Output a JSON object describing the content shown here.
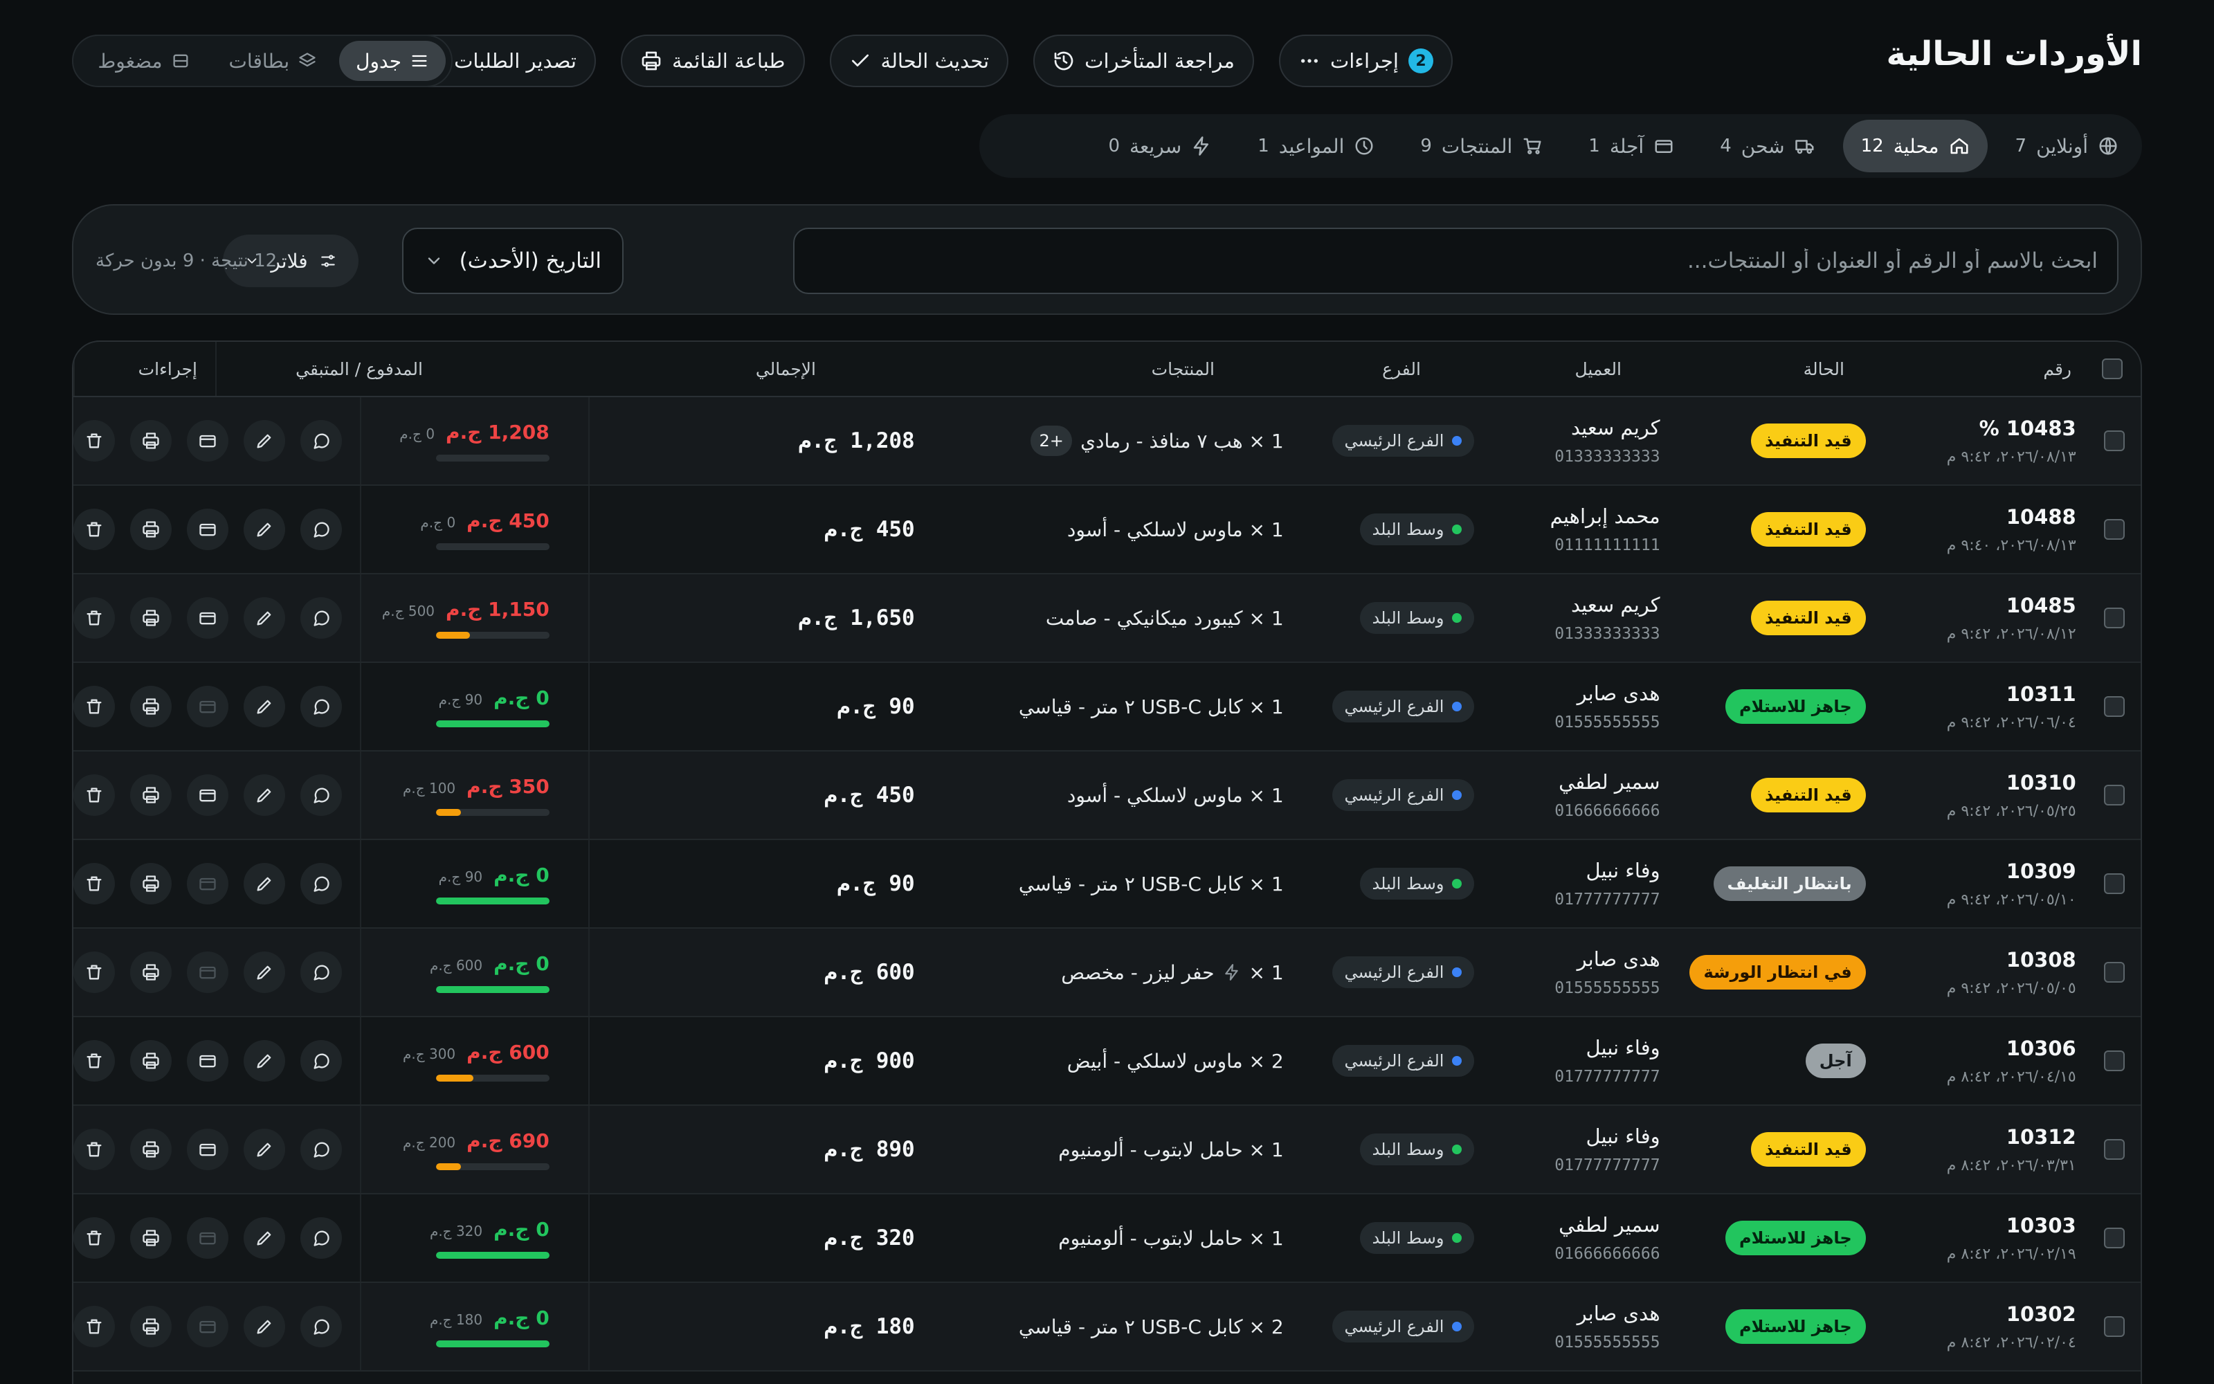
{
  "header": {
    "title": "الأوردات الحالية",
    "actions_label": "إجراءات",
    "actions_badge": "2",
    "review_late_label": "مراجعة المتأخرات",
    "update_status_label": "تحديث الحالة",
    "print_list_label": "طباعة القائمة",
    "export_orders_label": "تصدير الطلبات",
    "view_modes": [
      {
        "label": "جدول",
        "icon": "list-icon",
        "active": true
      },
      {
        "label": "بطاقات",
        "icon": "layers-icon",
        "active": false
      },
      {
        "label": "مضغوط",
        "icon": "compact-icon",
        "active": false
      }
    ]
  },
  "tabs": [
    {
      "label": "أونلاين",
      "count": "7",
      "icon": "globe-icon",
      "active": false
    },
    {
      "label": "محلية",
      "count": "12",
      "icon": "home-icon",
      "active": true
    },
    {
      "label": "شحن",
      "count": "4",
      "icon": "truck-icon",
      "active": false
    },
    {
      "label": "آجلة",
      "count": "1",
      "icon": "wallet-icon",
      "active": false
    },
    {
      "label": "المنتجات",
      "count": "9",
      "icon": "cart-icon",
      "active": false
    },
    {
      "label": "المواعيد",
      "count": "1",
      "icon": "clock-icon",
      "active": false
    },
    {
      "label": "سريعة",
      "count": "0",
      "icon": "bolt-icon",
      "active": false
    }
  ],
  "search": {
    "placeholder": "ابحث بالاسم أو الرقم أو العنوان أو المنتجات...",
    "value": "",
    "sort_label": "التاريخ (الأحدث)",
    "filter_label": "فلاتر",
    "result_info": "12 نتيجة · 9 بدون حركة"
  },
  "table": {
    "headers": {
      "num": "رقم",
      "status": "الحالة",
      "client": "العميل",
      "branch": "الفرع",
      "products": "المنتجات",
      "total": "الإجمالي",
      "paid": "المدفوع / المتبقي",
      "actions": "إجراءات"
    },
    "rows": [
      {
        "num": "10483 %",
        "date": "٢٠٢٦/٠٨/١٣، ٩:٤٢ م",
        "status": "قيد التنفيذ",
        "status_kind": "yellow",
        "client": "كريم سعيد",
        "phone": "01333333333",
        "branch": "الفرع الرئيسي",
        "branch_color": "#3b82f6",
        "product": "1 × هب ٧ منافذ - رمادي",
        "more": "+2",
        "bolt": false,
        "total": "1,208 ج.م",
        "paid_sub": "0 ج.م",
        "remaining": "1,208 ج.م",
        "paid_fraction": 0,
        "remaining_color": "#ef4444",
        "receipt_enabled": true
      },
      {
        "num": "10488",
        "date": "٢٠٢٦/٠٨/١٣، ٩:٤٠ م",
        "status": "قيد التنفيذ",
        "status_kind": "yellow",
        "client": "محمد إبراهيم",
        "phone": "01111111111",
        "branch": "وسط البلد",
        "branch_color": "#22c55e",
        "product": "1 × ماوس لاسلكي - أسود",
        "more": "",
        "bolt": false,
        "total": "450 ج.م",
        "paid_sub": "0 ج.م",
        "remaining": "450 ج.م",
        "paid_fraction": 0,
        "remaining_color": "#ef4444",
        "receipt_enabled": true
      },
      {
        "num": "10485",
        "date": "٢٠٢٦/٠٨/١٢، ٩:٤٢ م",
        "status": "قيد التنفيذ",
        "status_kind": "yellow",
        "client": "كريم سعيد",
        "phone": "01333333333",
        "branch": "وسط البلد",
        "branch_color": "#22c55e",
        "product": "1 × كيبورد ميكانيكي - صامت",
        "more": "",
        "bolt": false,
        "total": "1,650 ج.م",
        "paid_sub": "500 ج.م",
        "remaining": "1,150 ج.م",
        "paid_fraction": 0.3,
        "remaining_color": "#ef4444",
        "receipt_enabled": true
      },
      {
        "num": "10311",
        "date": "٢٠٢٦/٠٦/٠٤، ٩:٤٢ م",
        "status": "جاهز للاستلام",
        "status_kind": "green",
        "client": "هدى صابر",
        "phone": "01555555555",
        "branch": "الفرع الرئيسي",
        "branch_color": "#3b82f6",
        "product": "1 × كابل USB-C ٢ متر - قياسي",
        "more": "",
        "bolt": false,
        "total": "90 ج.م",
        "paid_sub": "90 ج.م",
        "remaining": "0 ج.م",
        "paid_fraction": 1,
        "remaining_color": "#22c55e",
        "receipt_enabled": false
      },
      {
        "num": "10310",
        "date": "٢٠٢٦/٠٥/٢٥، ٩:٤٢ م",
        "status": "قيد التنفيذ",
        "status_kind": "yellow",
        "client": "سمير لطفي",
        "phone": "01666666666",
        "branch": "الفرع الرئيسي",
        "branch_color": "#3b82f6",
        "product": "1 × ماوس لاسلكي - أسود",
        "more": "",
        "bolt": false,
        "total": "450 ج.م",
        "paid_sub": "100 ج.م",
        "remaining": "350 ج.م",
        "paid_fraction": 0.22,
        "remaining_color": "#ef4444",
        "receipt_enabled": true
      },
      {
        "num": "10309",
        "date": "٢٠٢٦/٠٥/١٠، ٩:٤٢ م",
        "status": "بانتظار التغليف",
        "status_kind": "gray",
        "client": "وفاء نبيل",
        "phone": "01777777777",
        "branch": "وسط البلد",
        "branch_color": "#22c55e",
        "product": "1 × كابل USB-C ٢ متر - قياسي",
        "more": "",
        "bolt": false,
        "total": "90 ج.م",
        "paid_sub": "90 ج.م",
        "remaining": "0 ج.م",
        "paid_fraction": 1,
        "remaining_color": "#22c55e",
        "receipt_enabled": false
      },
      {
        "num": "10308",
        "date": "٢٠٢٦/٠٥/٠٥، ٩:٤٢ م",
        "status": "في انتظار الورشة",
        "status_kind": "orange",
        "client": "هدى صابر",
        "phone": "01555555555",
        "branch": "الفرع الرئيسي",
        "branch_color": "#3b82f6",
        "product": "حفر ليزر - مخصص",
        "product_qty": "1 ×",
        "more": "",
        "bolt": true,
        "total": "600 ج.م",
        "paid_sub": "600 ج.م",
        "remaining": "0 ج.م",
        "paid_fraction": 1,
        "remaining_color": "#22c55e",
        "receipt_enabled": false
      },
      {
        "num": "10306",
        "date": "٢٠٢٦/٠٤/١٥، ٨:٤٢ م",
        "status": "آجل",
        "status_kind": "lightgray",
        "client": "وفاء نبيل",
        "phone": "01777777777",
        "branch": "الفرع الرئيسي",
        "branch_color": "#3b82f6",
        "product": "2 × ماوس لاسلكي - أبيض",
        "more": "",
        "bolt": false,
        "total": "900 ج.م",
        "paid_sub": "300 ج.م",
        "remaining": "600 ج.م",
        "paid_fraction": 0.33,
        "remaining_color": "#ef4444",
        "receipt_enabled": true
      },
      {
        "num": "10312",
        "date": "٢٠٢٦/٠٣/٣١، ٨:٤٢ م",
        "status": "قيد التنفيذ",
        "status_kind": "yellow",
        "client": "وفاء نبيل",
        "phone": "01777777777",
        "branch": "وسط البلد",
        "branch_color": "#22c55e",
        "product": "1 × حامل لابتوب - ألومنيوم",
        "more": "",
        "bolt": false,
        "total": "890 ج.م",
        "paid_sub": "200 ج.م",
        "remaining": "690 ج.م",
        "paid_fraction": 0.22,
        "remaining_color": "#ef4444",
        "receipt_enabled": true
      },
      {
        "num": "10303",
        "date": "٢٠٢٦/٠٢/١٩، ٨:٤٢ م",
        "status": "جاهز للاستلام",
        "status_kind": "green",
        "client": "سمير لطفي",
        "phone": "01666666666",
        "branch": "وسط البلد",
        "branch_color": "#22c55e",
        "product": "1 × حامل لابتوب - ألومنيوم",
        "more": "",
        "bolt": false,
        "total": "320 ج.م",
        "paid_sub": "320 ج.م",
        "remaining": "0 ج.م",
        "paid_fraction": 1,
        "remaining_color": "#22c55e",
        "receipt_enabled": false
      },
      {
        "num": "10302",
        "date": "٢٠٢٦/٠٢/٠٤، ٨:٤٢ م",
        "status": "جاهز للاستلام",
        "status_kind": "green",
        "client": "هدى صابر",
        "phone": "01555555555",
        "branch": "الفرع الرئيسي",
        "branch_color": "#3b82f6",
        "product": "2 × كابل USB-C ٢ متر - قياسي",
        "more": "",
        "bolt": false,
        "total": "180 ج.م",
        "paid_sub": "180 ج.م",
        "remaining": "0 ج.م",
        "paid_fraction": 1,
        "remaining_color": "#22c55e",
        "receipt_enabled": false
      }
    ]
  },
  "colors": {
    "accent_cyan": "#22b8e6",
    "status_yellow": "#facc15",
    "status_green": "#22c55e",
    "status_orange": "#f59e0b",
    "status_gray": "#6b7378",
    "status_lightgray": "#9aa2a6",
    "remaining_red": "#ef4444",
    "bar_orange": "#f59e0b"
  }
}
